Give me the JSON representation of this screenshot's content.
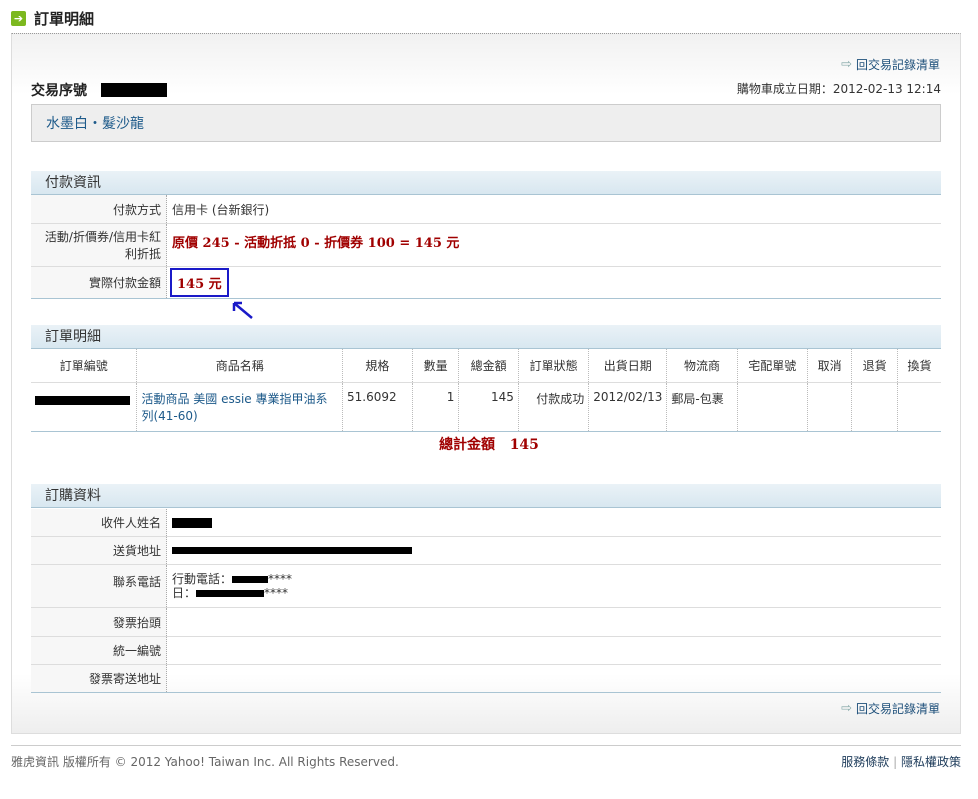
{
  "page_title": "訂單明細",
  "back_link": "回交易記錄清單",
  "txn_label": "交易序號",
  "cart_date": "購物車成立日期：2012-02-13 12:14",
  "shop_name": "水墨白・髮沙龍",
  "payment": {
    "title": "付款資訊",
    "rows": [
      {
        "label": "付款方式",
        "value": "信用卡 (台新銀行)"
      },
      {
        "label": "活動/折價券/信用卡紅利折抵",
        "value": "原價 245 - 活動折抵 0 - 折價券 100 = 145 元"
      },
      {
        "label": "實際付款金額",
        "value": "145 元"
      }
    ]
  },
  "order": {
    "title": "訂單明細",
    "headers": [
      "訂單編號",
      "商品名稱",
      "規格",
      "數量",
      "總金額",
      "訂單狀態",
      "出貨日期",
      "物流商",
      "宅配單號",
      "取消",
      "退貨",
      "換貨"
    ],
    "row": {
      "product": "活動商品 美國 essie 專業指甲油系列(41-60)",
      "spec": "51.6092",
      "qty": "1",
      "amount": "145",
      "status": "付款成功",
      "ship_date": "2012/02/13",
      "carrier": "郵局-包裹"
    },
    "total_label": "總計金額",
    "total": "145"
  },
  "buyer": {
    "title": "訂購資料",
    "rows": [
      {
        "label": "收件人姓名"
      },
      {
        "label": "送貨地址"
      },
      {
        "label": "聯系電話",
        "mobile": "行動電話：",
        "mobile_mask": "****",
        "day": "日：",
        "day_mask": "****"
      },
      {
        "label": "發票抬頭"
      },
      {
        "label": "統一編號"
      },
      {
        "label": "發票寄送地址"
      }
    ]
  },
  "footer": {
    "copyright": "雅虎資訊 版權所有 © 2012 Yahoo! Taiwan Inc. All Rights Reserved.",
    "terms": "服務條款",
    "sep": "|",
    "privacy": "隱私權政策"
  }
}
